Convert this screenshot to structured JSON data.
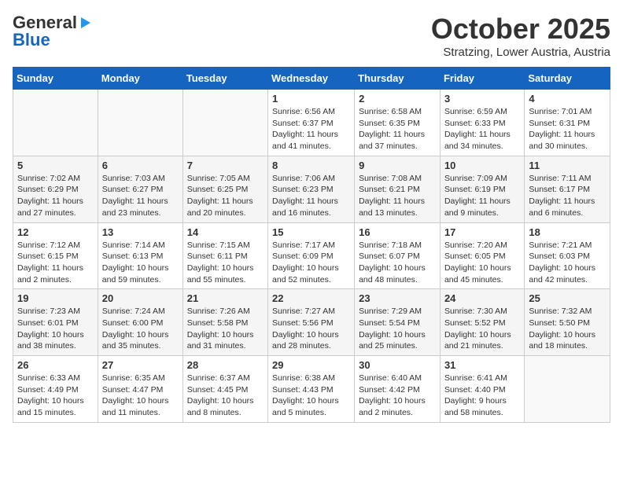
{
  "header": {
    "logo_general": "General",
    "logo_blue": "Blue",
    "month": "October 2025",
    "location": "Stratzing, Lower Austria, Austria"
  },
  "days_of_week": [
    "Sunday",
    "Monday",
    "Tuesday",
    "Wednesday",
    "Thursday",
    "Friday",
    "Saturday"
  ],
  "weeks": [
    [
      {
        "day": "",
        "info": ""
      },
      {
        "day": "",
        "info": ""
      },
      {
        "day": "",
        "info": ""
      },
      {
        "day": "1",
        "info": "Sunrise: 6:56 AM\nSunset: 6:37 PM\nDaylight: 11 hours and 41 minutes."
      },
      {
        "day": "2",
        "info": "Sunrise: 6:58 AM\nSunset: 6:35 PM\nDaylight: 11 hours and 37 minutes."
      },
      {
        "day": "3",
        "info": "Sunrise: 6:59 AM\nSunset: 6:33 PM\nDaylight: 11 hours and 34 minutes."
      },
      {
        "day": "4",
        "info": "Sunrise: 7:01 AM\nSunset: 6:31 PM\nDaylight: 11 hours and 30 minutes."
      }
    ],
    [
      {
        "day": "5",
        "info": "Sunrise: 7:02 AM\nSunset: 6:29 PM\nDaylight: 11 hours and 27 minutes."
      },
      {
        "day": "6",
        "info": "Sunrise: 7:03 AM\nSunset: 6:27 PM\nDaylight: 11 hours and 23 minutes."
      },
      {
        "day": "7",
        "info": "Sunrise: 7:05 AM\nSunset: 6:25 PM\nDaylight: 11 hours and 20 minutes."
      },
      {
        "day": "8",
        "info": "Sunrise: 7:06 AM\nSunset: 6:23 PM\nDaylight: 11 hours and 16 minutes."
      },
      {
        "day": "9",
        "info": "Sunrise: 7:08 AM\nSunset: 6:21 PM\nDaylight: 11 hours and 13 minutes."
      },
      {
        "day": "10",
        "info": "Sunrise: 7:09 AM\nSunset: 6:19 PM\nDaylight: 11 hours and 9 minutes."
      },
      {
        "day": "11",
        "info": "Sunrise: 7:11 AM\nSunset: 6:17 PM\nDaylight: 11 hours and 6 minutes."
      }
    ],
    [
      {
        "day": "12",
        "info": "Sunrise: 7:12 AM\nSunset: 6:15 PM\nDaylight: 11 hours and 2 minutes."
      },
      {
        "day": "13",
        "info": "Sunrise: 7:14 AM\nSunset: 6:13 PM\nDaylight: 10 hours and 59 minutes."
      },
      {
        "day": "14",
        "info": "Sunrise: 7:15 AM\nSunset: 6:11 PM\nDaylight: 10 hours and 55 minutes."
      },
      {
        "day": "15",
        "info": "Sunrise: 7:17 AM\nSunset: 6:09 PM\nDaylight: 10 hours and 52 minutes."
      },
      {
        "day": "16",
        "info": "Sunrise: 7:18 AM\nSunset: 6:07 PM\nDaylight: 10 hours and 48 minutes."
      },
      {
        "day": "17",
        "info": "Sunrise: 7:20 AM\nSunset: 6:05 PM\nDaylight: 10 hours and 45 minutes."
      },
      {
        "day": "18",
        "info": "Sunrise: 7:21 AM\nSunset: 6:03 PM\nDaylight: 10 hours and 42 minutes."
      }
    ],
    [
      {
        "day": "19",
        "info": "Sunrise: 7:23 AM\nSunset: 6:01 PM\nDaylight: 10 hours and 38 minutes."
      },
      {
        "day": "20",
        "info": "Sunrise: 7:24 AM\nSunset: 6:00 PM\nDaylight: 10 hours and 35 minutes."
      },
      {
        "day": "21",
        "info": "Sunrise: 7:26 AM\nSunset: 5:58 PM\nDaylight: 10 hours and 31 minutes."
      },
      {
        "day": "22",
        "info": "Sunrise: 7:27 AM\nSunset: 5:56 PM\nDaylight: 10 hours and 28 minutes."
      },
      {
        "day": "23",
        "info": "Sunrise: 7:29 AM\nSunset: 5:54 PM\nDaylight: 10 hours and 25 minutes."
      },
      {
        "day": "24",
        "info": "Sunrise: 7:30 AM\nSunset: 5:52 PM\nDaylight: 10 hours and 21 minutes."
      },
      {
        "day": "25",
        "info": "Sunrise: 7:32 AM\nSunset: 5:50 PM\nDaylight: 10 hours and 18 minutes."
      }
    ],
    [
      {
        "day": "26",
        "info": "Sunrise: 6:33 AM\nSunset: 4:49 PM\nDaylight: 10 hours and 15 minutes."
      },
      {
        "day": "27",
        "info": "Sunrise: 6:35 AM\nSunset: 4:47 PM\nDaylight: 10 hours and 11 minutes."
      },
      {
        "day": "28",
        "info": "Sunrise: 6:37 AM\nSunset: 4:45 PM\nDaylight: 10 hours and 8 minutes."
      },
      {
        "day": "29",
        "info": "Sunrise: 6:38 AM\nSunset: 4:43 PM\nDaylight: 10 hours and 5 minutes."
      },
      {
        "day": "30",
        "info": "Sunrise: 6:40 AM\nSunset: 4:42 PM\nDaylight: 10 hours and 2 minutes."
      },
      {
        "day": "31",
        "info": "Sunrise: 6:41 AM\nSunset: 4:40 PM\nDaylight: 9 hours and 58 minutes."
      },
      {
        "day": "",
        "info": ""
      }
    ]
  ]
}
